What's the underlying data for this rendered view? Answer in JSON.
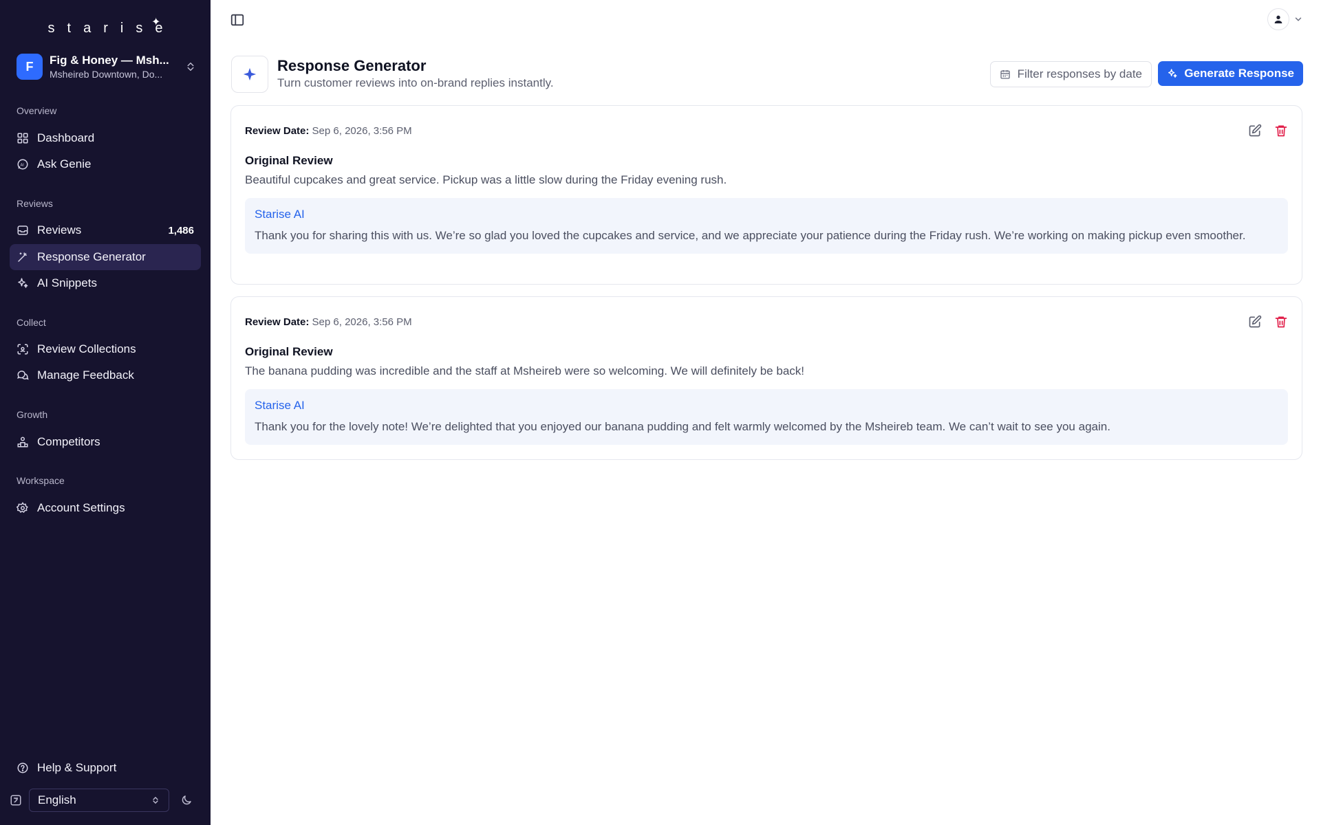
{
  "brand": {
    "logo_text": "starise",
    "logo_mark": "✦"
  },
  "org": {
    "initial": "F",
    "name": "Fig & Honey — Msh...",
    "location": "Msheireb Downtown, Do..."
  },
  "sidebar": {
    "sections": [
      {
        "label": "Overview"
      },
      {
        "label": "Reviews"
      },
      {
        "label": "Collect"
      },
      {
        "label": "Growth"
      },
      {
        "label": "Workspace"
      }
    ],
    "items": [
      {
        "label": "Dashboard",
        "icon": "grid-icon"
      },
      {
        "label": "Ask Genie",
        "icon": "ai-chat-icon"
      },
      {
        "label": "Reviews",
        "icon": "inbox-icon",
        "count": "1,486"
      },
      {
        "label": "Response Generator",
        "icon": "magic-wand-icon",
        "active": true
      },
      {
        "label": "AI Snippets",
        "icon": "sparkle-icon"
      },
      {
        "label": "Review Collections",
        "icon": "scan-icon"
      },
      {
        "label": "Manage Feedback",
        "icon": "chat-bubbles-icon"
      },
      {
        "label": "Competitors",
        "icon": "podium-icon"
      },
      {
        "label": "Account Settings",
        "icon": "gear-icon"
      }
    ],
    "help_label": "Help & Support",
    "language": "English"
  },
  "header": {
    "title": "Response Generator",
    "subtitle": "Turn customer reviews into on-brand replies instantly.",
    "filter_placeholder": "Filter responses by date",
    "generate_label": "Generate Response"
  },
  "reviews": [
    {
      "date_label": "Review Date:",
      "date": "Sep 6, 2026, 3:56 PM",
      "original_label": "Original Review",
      "original": "Beautiful cupcakes and great service. Pickup was a little slow during the Friday evening rush.",
      "ai_name": "Starise AI",
      "ai_reply": "Thank you for sharing this with us. We’re so glad you loved the cupcakes and service, and we appreciate your patience during the Friday rush. We’re working on making pickup even smoother."
    },
    {
      "date_label": "Review Date:",
      "date": "Sep 6, 2026, 3:56 PM",
      "original_label": "Original Review",
      "original": "The banana pudding was incredible and the staff at Msheireb were so welcoming. We will definitely be back!",
      "ai_name": "Starise AI",
      "ai_reply": "Thank you for the lovely note! We’re delighted that you enjoyed our banana pudding and felt warmly welcomed by the Msheireb team. We can’t wait to see you again."
    }
  ],
  "colors": {
    "sidebar_bg": "#16132e",
    "accent": "#2563eb",
    "danger": "#e11d48",
    "active_item": "#2a2550"
  }
}
